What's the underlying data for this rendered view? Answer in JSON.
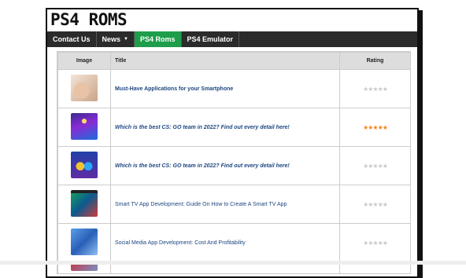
{
  "site": {
    "title": "PS4 ROMS"
  },
  "nav": {
    "items": [
      {
        "label": "Contact Us"
      },
      {
        "label": "News",
        "has_caret": true
      },
      {
        "label": "PS4 Roms",
        "active": true
      },
      {
        "label": "PS4 Emulator"
      }
    ],
    "active_color": "#1e9e4a"
  },
  "table": {
    "headers": {
      "image": "Image",
      "title": "Title",
      "rating": "Rating"
    },
    "rows": [
      {
        "title": "Must-Have Applications for your Smartphone",
        "style": "bold",
        "rating": 0,
        "thumb": "smartphone-in-hand"
      },
      {
        "title": "Which is the best CS: GO team in 2022? Find out every detail here!",
        "style": "bold-italic",
        "rating": 5,
        "thumb": "esports-stage"
      },
      {
        "title": "Which is the best CS: GO team in 2022? Find out every detail here!",
        "style": "bold-italic",
        "rating": 0,
        "thumb": "esports-players"
      },
      {
        "title": "Smart TV App Development: Guide On How to Create A Smart TV App",
        "style": "normal",
        "rating": 0,
        "thumb": "smart-tv"
      },
      {
        "title": "Social Media App Development: Cost And Profitability",
        "style": "normal",
        "rating": 0,
        "thumb": "social-media-phones"
      },
      {
        "title": "",
        "style": "normal",
        "rating": 0,
        "thumb": "partial",
        "partial": true
      }
    ],
    "max_rating": 5,
    "star_on_color": "#f0851b",
    "star_off_color": "#c9c9c9"
  }
}
